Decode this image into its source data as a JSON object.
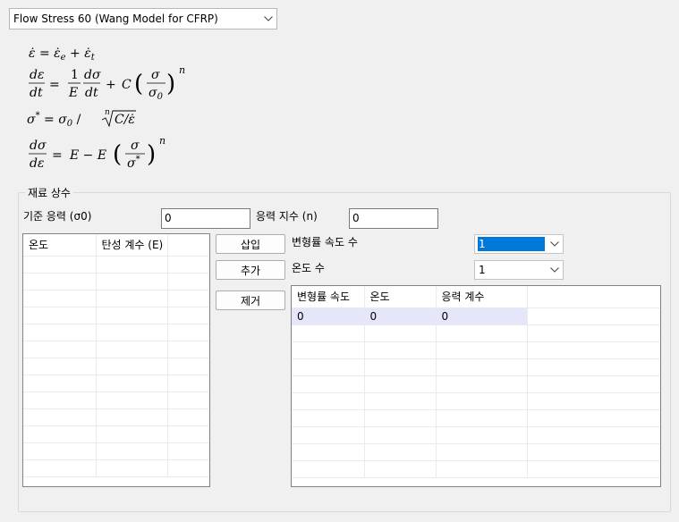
{
  "model_select": {
    "value": "Flow Stress 60 (Wang Model for CFRP)"
  },
  "material": {
    "group_title": "재료 상수",
    "ref_stress_label": "기준 응력 (σ0)",
    "ref_stress_value": "0",
    "stress_exp_label": "응력 지수 (n)",
    "stress_exp_value": "0"
  },
  "elastic_table": {
    "columns": [
      "온도",
      "탄성 계수 (E)"
    ]
  },
  "buttons": {
    "insert": "삽입",
    "add": "추가",
    "remove": "제거"
  },
  "strain_rate_count": {
    "label": "변형률 속도 수",
    "value": "1"
  },
  "temp_count": {
    "label": "온도 수",
    "value": "1"
  },
  "coef_table": {
    "columns": [
      "변형률 속도",
      "온도",
      "응력 계수"
    ],
    "rows": [
      [
        "0",
        "0",
        "0"
      ]
    ]
  }
}
